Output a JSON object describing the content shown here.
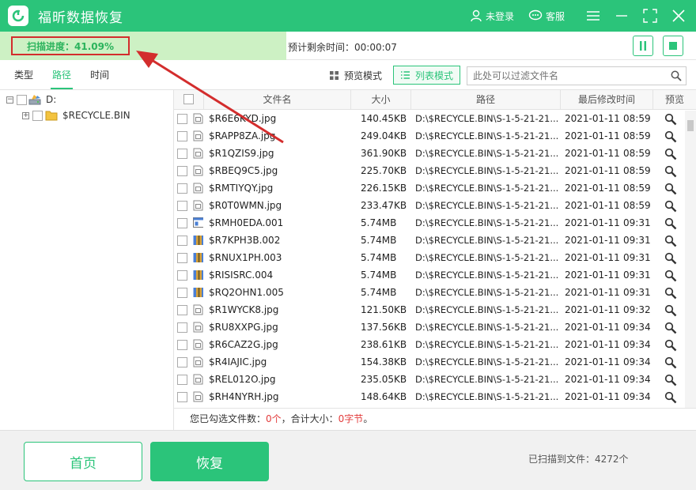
{
  "app": {
    "title": "福昕数据恢复",
    "login": "未登录",
    "service": "客服"
  },
  "scan": {
    "progress_label": "扫描进度：41.09%",
    "progress_fraction": 0.4109,
    "remaining": "预计剩余时间：00:00:07"
  },
  "tabs": [
    {
      "label": "类型"
    },
    {
      "label": "路径"
    },
    {
      "label": "时间"
    }
  ],
  "modes": {
    "preview": "预览模式",
    "list": "列表模式"
  },
  "filter": {
    "placeholder": "此处可以过滤文件名"
  },
  "tree": {
    "drive": "D:",
    "folder": "$RECYCLE.BIN"
  },
  "columns": {
    "name": "文件名",
    "size": "大小",
    "path": "路径",
    "modified": "最后修改时间",
    "preview": "预览"
  },
  "rows": [
    {
      "name": "$R6E6KYD.jpg",
      "size": "140.45KB",
      "path": "D:\\$RECYCLE.BIN\\S-1-5-21-21...",
      "date": "2021-01-11",
      "time": "08:59",
      "icon": "jpg"
    },
    {
      "name": "$RAPP8ZA.jpg",
      "size": "249.04KB",
      "path": "D:\\$RECYCLE.BIN\\S-1-5-21-21...",
      "date": "2021-01-11",
      "time": "08:59",
      "icon": "jpg"
    },
    {
      "name": "$R1QZIS9.jpg",
      "size": "361.90KB",
      "path": "D:\\$RECYCLE.BIN\\S-1-5-21-21...",
      "date": "2021-01-11",
      "time": "08:59",
      "icon": "jpg"
    },
    {
      "name": "$RBEQ9C5.jpg",
      "size": "225.70KB",
      "path": "D:\\$RECYCLE.BIN\\S-1-5-21-21...",
      "date": "2021-01-11",
      "time": "08:59",
      "icon": "jpg"
    },
    {
      "name": "$RMTIYQY.jpg",
      "size": "226.15KB",
      "path": "D:\\$RECYCLE.BIN\\S-1-5-21-21...",
      "date": "2021-01-11",
      "time": "08:59",
      "icon": "jpg"
    },
    {
      "name": "$R0T0WMN.jpg",
      "size": "233.47KB",
      "path": "D:\\$RECYCLE.BIN\\S-1-5-21-21...",
      "date": "2021-01-11",
      "time": "08:59",
      "icon": "jpg"
    },
    {
      "name": "$RMH0EDA.001",
      "size": "5.74MB",
      "path": "D:\\$RECYCLE.BIN\\S-1-5-21-21...",
      "date": "2021-01-11",
      "time": "09:31",
      "icon": "window"
    },
    {
      "name": "$R7KPH3B.002",
      "size": "5.74MB",
      "path": "D:\\$RECYCLE.BIN\\S-1-5-21-21...",
      "date": "2021-01-11",
      "time": "09:31",
      "icon": "archive"
    },
    {
      "name": "$RNUX1PH.003",
      "size": "5.74MB",
      "path": "D:\\$RECYCLE.BIN\\S-1-5-21-21...",
      "date": "2021-01-11",
      "time": "09:31",
      "icon": "archive"
    },
    {
      "name": "$RISISRC.004",
      "size": "5.74MB",
      "path": "D:\\$RECYCLE.BIN\\S-1-5-21-21...",
      "date": "2021-01-11",
      "time": "09:31",
      "icon": "archive"
    },
    {
      "name": "$RQ2OHN1.005",
      "size": "5.74MB",
      "path": "D:\\$RECYCLE.BIN\\S-1-5-21-21...",
      "date": "2021-01-11",
      "time": "09:31",
      "icon": "archive"
    },
    {
      "name": "$R1WYCK8.jpg",
      "size": "121.50KB",
      "path": "D:\\$RECYCLE.BIN\\S-1-5-21-21...",
      "date": "2021-01-11",
      "time": "09:32",
      "icon": "jpg"
    },
    {
      "name": "$RU8XXPG.jpg",
      "size": "137.56KB",
      "path": "D:\\$RECYCLE.BIN\\S-1-5-21-21...",
      "date": "2021-01-11",
      "time": "09:34",
      "icon": "jpg"
    },
    {
      "name": "$R6CAZ2G.jpg",
      "size": "238.61KB",
      "path": "D:\\$RECYCLE.BIN\\S-1-5-21-21...",
      "date": "2021-01-11",
      "time": "09:34",
      "icon": "jpg"
    },
    {
      "name": "$R4IAJIC.jpg",
      "size": "154.38KB",
      "path": "D:\\$RECYCLE.BIN\\S-1-5-21-21...",
      "date": "2021-01-11",
      "time": "09:34",
      "icon": "jpg"
    },
    {
      "name": "$REL012O.jpg",
      "size": "235.05KB",
      "path": "D:\\$RECYCLE.BIN\\S-1-5-21-21...",
      "date": "2021-01-11",
      "time": "09:34",
      "icon": "jpg"
    },
    {
      "name": "$RH4NYRH.jpg",
      "size": "148.64KB",
      "path": "D:\\$RECYCLE.BIN\\S-1-5-21-21...",
      "date": "2021-01-11",
      "time": "09:34",
      "icon": "jpg"
    }
  ],
  "summary": {
    "prefix": "您已勾选文件数：",
    "count": "0个",
    "mid": "，合计大小：",
    "size": "0字节",
    "suffix": "。"
  },
  "footer": {
    "home": "首页",
    "recover": "恢复",
    "scanned": "已扫描到文件：4272个"
  },
  "colors": {
    "accent": "#2bc47a",
    "highlight": "#d32d2d",
    "progress_fill": "#cdf1c4"
  }
}
